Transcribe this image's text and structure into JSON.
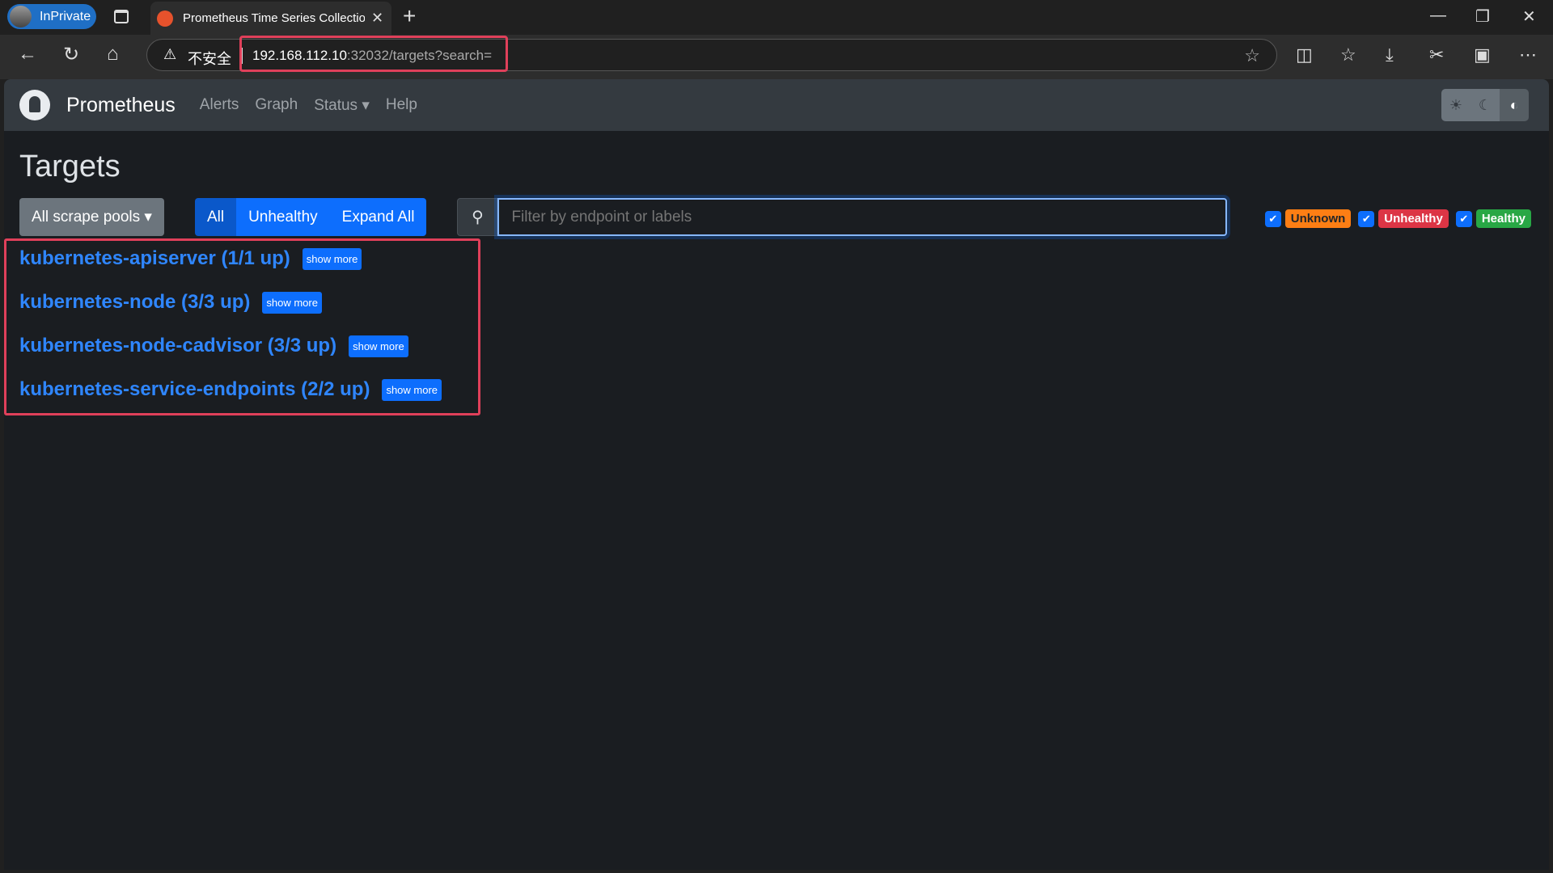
{
  "browser": {
    "inprivate": "InPrivate",
    "tab_title": "Prometheus Time Series Collection and Processing Server",
    "url_host": "192.168.112.10",
    "url_rest": ":32032/targets?search=",
    "insecure_label": "不安全"
  },
  "nav": {
    "brand": "Prometheus",
    "links": [
      "Alerts",
      "Graph",
      "Status",
      "Help"
    ]
  },
  "page": {
    "title": "Targets",
    "pools_button": "All scrape pools",
    "filters": [
      "All",
      "Unhealthy",
      "Expand All"
    ],
    "search_placeholder": "Filter by endpoint or labels",
    "states": [
      {
        "label": "Unknown",
        "color": "#fd7e14"
      },
      {
        "label": "Unhealthy",
        "color": "#dc3545"
      },
      {
        "label": "Healthy",
        "color": "#28a745"
      }
    ],
    "pools": [
      {
        "name": "kubernetes-apiserver (1/1 up)",
        "more": "show more"
      },
      {
        "name": "kubernetes-node (3/3 up)",
        "more": "show more"
      },
      {
        "name": "kubernetes-node-cadvisor (3/3 up)",
        "more": "show more"
      },
      {
        "name": "kubernetes-service-endpoints (2/2 up)",
        "more": "show more"
      }
    ]
  }
}
